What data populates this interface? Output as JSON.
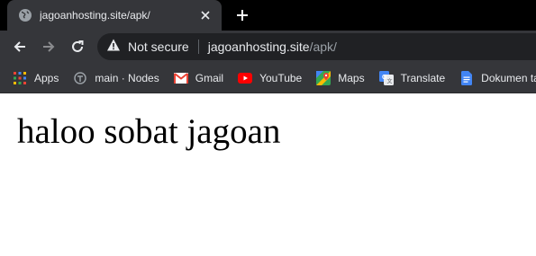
{
  "tab": {
    "title": "jagoanhosting.site/apk/"
  },
  "omnibox": {
    "security_label": "Not secure",
    "url_host": "jagoanhosting.site",
    "url_path": "/apk/"
  },
  "bookmarks": [
    {
      "label": "Apps",
      "icon": "apps-grid-icon"
    },
    {
      "label": "main · Nodes",
      "icon": "nodes-icon"
    },
    {
      "label": "Gmail",
      "icon": "gmail-icon"
    },
    {
      "label": "YouTube",
      "icon": "youtube-icon"
    },
    {
      "label": "Maps",
      "icon": "maps-icon"
    },
    {
      "label": "Translate",
      "icon": "translate-icon"
    },
    {
      "label": "Dokumen ta",
      "icon": "docs-icon"
    }
  ],
  "page": {
    "heading": "haloo sobat jagoan"
  },
  "colors": {
    "tabstrip": "#000000",
    "toolbar": "#35363a",
    "omnibox": "#202124",
    "text_light": "#e8eaed",
    "page_bg": "#ffffff"
  }
}
